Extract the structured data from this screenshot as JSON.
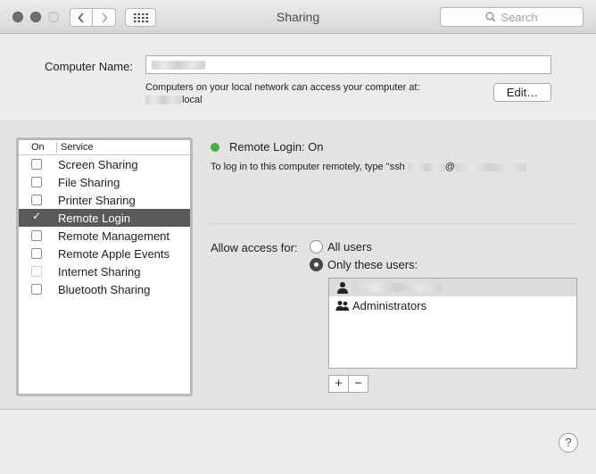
{
  "window": {
    "title": "Sharing"
  },
  "toolbar": {
    "search_placeholder": "Search"
  },
  "computer_name": {
    "label": "Computer Name:",
    "hint_line1": "Computers on your local network can access your computer at:",
    "hint_suffix": "local",
    "edit_label": "Edit…"
  },
  "services": {
    "header_on": "On",
    "header_service": "Service",
    "items": [
      {
        "label": "Screen Sharing",
        "checked": false
      },
      {
        "label": "File Sharing",
        "checked": false
      },
      {
        "label": "Printer Sharing",
        "checked": false
      },
      {
        "label": "Remote Login",
        "checked": true,
        "selected": true
      },
      {
        "label": "Remote Management",
        "checked": false
      },
      {
        "label": "Remote Apple Events",
        "checked": false
      },
      {
        "label": "Internet Sharing",
        "checked": false,
        "disabled": true
      },
      {
        "label": "Bluetooth Sharing",
        "checked": false
      }
    ]
  },
  "detail": {
    "status_text": "Remote Login: On",
    "status_color": "#3fb43c",
    "ssh_prefix": "To log in to this computer remotely, type \"ssh",
    "ssh_at": "@",
    "access_label": "Allow access for:",
    "option_all": "All users",
    "option_only": "Only these users:",
    "selected_option": "Only these users:",
    "users": [
      {
        "icon": "user-icon",
        "label": ""
      },
      {
        "icon": "group-icon",
        "label": "Administrators"
      }
    ],
    "add_label": "+",
    "remove_label": "−"
  },
  "footer": {
    "help_label": "?"
  }
}
